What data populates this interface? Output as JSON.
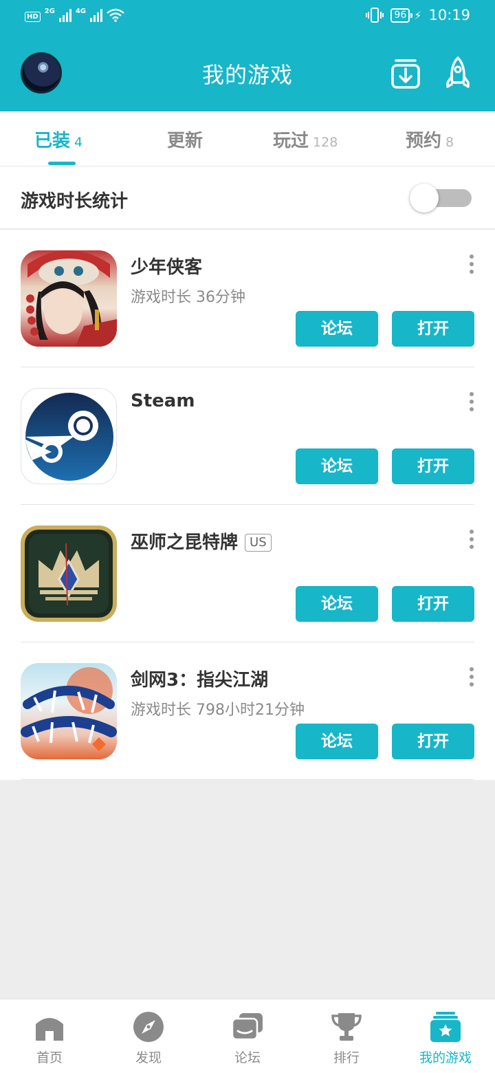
{
  "status_bar": {
    "hd_label": "HD",
    "net1": "2G",
    "net2": "4G",
    "battery": "96",
    "time": "10:19"
  },
  "header": {
    "title": "我的游戏",
    "icons": [
      "avatar",
      "download-icon",
      "rocket-icon"
    ]
  },
  "tabs": [
    {
      "label": "已装",
      "count": "4",
      "active": true
    },
    {
      "label": "更新",
      "count": "",
      "active": false
    },
    {
      "label": "玩过",
      "count": "128",
      "active": false
    },
    {
      "label": "预约",
      "count": "8",
      "active": false
    }
  ],
  "stats": {
    "label": "游戏时长统计",
    "toggle_on": false
  },
  "games": [
    {
      "name": "少年侠客",
      "badge": "",
      "playtime": "游戏时长 36分钟",
      "forum_label": "论坛",
      "open_label": "打开"
    },
    {
      "name": "Steam",
      "badge": "",
      "playtime": "",
      "forum_label": "论坛",
      "open_label": "打开"
    },
    {
      "name": "巫师之昆特牌",
      "badge": "US",
      "playtime": "",
      "forum_label": "论坛",
      "open_label": "打开"
    },
    {
      "name": "剑网3：指尖江湖",
      "badge": "",
      "playtime": "游戏时长 798小时21分钟",
      "forum_label": "论坛",
      "open_label": "打开"
    }
  ],
  "bottom_nav": [
    {
      "label": "首页",
      "icon": "home-icon",
      "active": false
    },
    {
      "label": "发现",
      "icon": "compass-icon",
      "active": false
    },
    {
      "label": "论坛",
      "icon": "chat-icon",
      "active": false
    },
    {
      "label": "排行",
      "icon": "trophy-icon",
      "active": false
    },
    {
      "label": "我的游戏",
      "icon": "my-games-icon",
      "active": true
    }
  ],
  "colors": {
    "accent": "#17b6c8",
    "inactive": "#8a8a8a",
    "background": "#ededed"
  }
}
